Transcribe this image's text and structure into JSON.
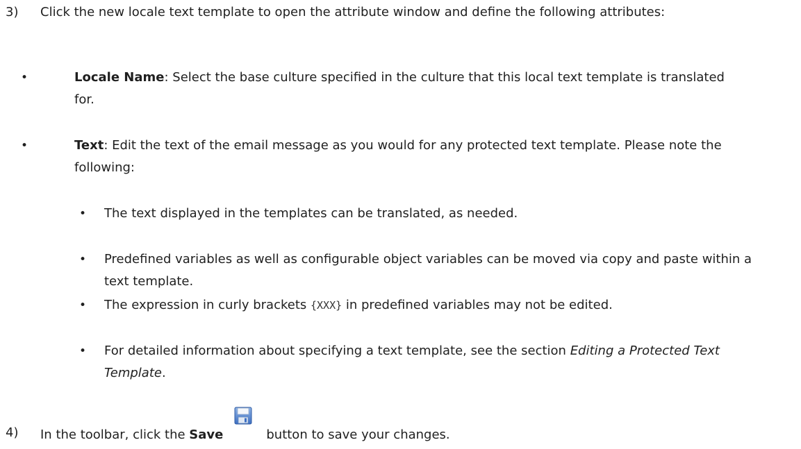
{
  "step3": {
    "number": "3)",
    "text": "Click the new locale text template to open the attribute window and define the following attributes:",
    "bullets": [
      {
        "term": "Locale Name",
        "text": ": Select the base culture specified in the culture that this local text template is translated for."
      },
      {
        "term": "Text",
        "text": ": Edit the text of the email message as you would for any protected text template. Please note the following:"
      }
    ],
    "subbullets": {
      "s1": "The text displayed in the templates can be translated, as needed.",
      "s2": "Predefined variables as well as configurable object variables can be moved via copy and paste within a text template.",
      "s3_before": "The expression in curly brackets ",
      "s3_code": "{XXX}",
      "s3_after": " in predefined variables may not be edited.",
      "s4_before": "For detailed information about specifying a text template, see the section ",
      "s4_link": "Editing a Protected Text Template",
      "s4_after": "."
    }
  },
  "step4": {
    "number": "4)",
    "before": "In the toolbar, click the ",
    "bold": "Save",
    "after": "button to save your changes.",
    "icon": "save-floppy-icon"
  },
  "bullet_glyph": "•"
}
